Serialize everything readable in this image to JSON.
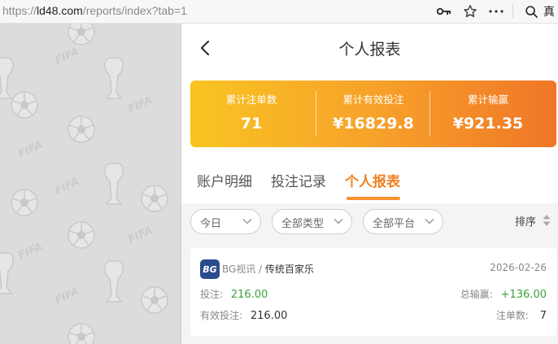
{
  "browser": {
    "url_prefix": "https://",
    "url_host": "ld48.com",
    "url_path": "/reports/index?tab=1",
    "icons": [
      "key-icon",
      "star-icon",
      "more-icon",
      "search-icon"
    ],
    "right_text": "真"
  },
  "header": {
    "title": "个人报表",
    "back_icon": "chevron-left-icon"
  },
  "summary": {
    "stats": [
      {
        "label": "累计注单数",
        "value": "71"
      },
      {
        "label": "累计有效投注",
        "value": "¥16829.8"
      },
      {
        "label": "累计输赢",
        "value": "¥921.35"
      }
    ],
    "gradient_colors": [
      "#f8c422",
      "#f07627"
    ]
  },
  "tabs": [
    {
      "label": "账户明细",
      "active": false
    },
    {
      "label": "投注记录",
      "active": false
    },
    {
      "label": "个人报表",
      "active": true
    }
  ],
  "filters": {
    "date": "今日",
    "type": "全部类型",
    "platform": "全部平台",
    "sort_label": "排序"
  },
  "record": {
    "logo_text": "BG",
    "provider": "BG视讯",
    "separator": "/",
    "game": "传统百家乐",
    "date": "2026-02-26",
    "bet_label": "投注:",
    "bet_value": "216.00",
    "total_winloss_label": "总输赢:",
    "total_winloss_value": "+136.00",
    "valid_bet_label": "有效投注:",
    "valid_bet_value": "216.00",
    "order_count_label": "注单数:",
    "order_count_value": "7"
  },
  "colors": {
    "accent": "#f07f22",
    "positive": "#3aa03a"
  }
}
